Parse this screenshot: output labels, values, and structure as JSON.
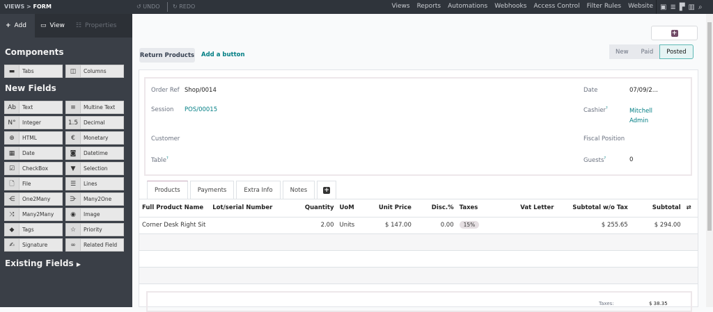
{
  "topbar": {
    "breadcrumb_views": "VIEWS",
    "breadcrumb_sep": ">",
    "breadcrumb_form": "FORM",
    "undo": "UNDO",
    "redo": "REDO",
    "nav": [
      "Views",
      "Reports",
      "Automations",
      "Webhooks",
      "Access Control",
      "Filter Rules",
      "Website"
    ],
    "view_icons": [
      "form-view-icon",
      "list-view-icon",
      "kanban-view-icon",
      "pivot-view-icon",
      "search-icon"
    ]
  },
  "sidebar": {
    "tabs": [
      {
        "label": "Add",
        "icon": "plus-icon"
      },
      {
        "label": "View",
        "icon": "monitor-icon"
      },
      {
        "label": "Properties",
        "icon": "properties-icon"
      }
    ],
    "components_title": "Components",
    "components": [
      {
        "label": "Tabs",
        "icon": "tabs-icon"
      },
      {
        "label": "Columns",
        "icon": "columns-icon"
      }
    ],
    "new_fields_title": "New Fields",
    "fields": [
      {
        "label": "Text",
        "icon": "Ab"
      },
      {
        "label": "Multine Text",
        "icon": "≡"
      },
      {
        "label": "Integer",
        "icon": "N°"
      },
      {
        "label": "Decimal",
        "icon": "1.5"
      },
      {
        "label": "HTML",
        "icon": "⊕"
      },
      {
        "label": "Monetary",
        "icon": "€"
      },
      {
        "label": "Date",
        "icon": "▦"
      },
      {
        "label": "Datetime",
        "icon": "◙"
      },
      {
        "label": "CheckBox",
        "icon": "☑"
      },
      {
        "label": "Selection",
        "icon": "▼"
      },
      {
        "label": "File",
        "icon": "🗋"
      },
      {
        "label": "Lines",
        "icon": "☰"
      },
      {
        "label": "One2Many",
        "icon": "⋲"
      },
      {
        "label": "Many2One",
        "icon": "⋺"
      },
      {
        "label": "Many2Many",
        "icon": "⤨"
      },
      {
        "label": "Image",
        "icon": "◉"
      },
      {
        "label": "Tags",
        "icon": "◆"
      },
      {
        "label": "Priority",
        "icon": "☆"
      },
      {
        "label": "Signature",
        "icon": "✍"
      },
      {
        "label": "Related Field",
        "icon": "∞"
      }
    ],
    "existing_fields": "Existing Fields"
  },
  "main": {
    "return_button": "Return Products",
    "add_button": "Add a button",
    "statusbar": [
      "New",
      "Paid",
      "Posted"
    ],
    "status_current": "Posted",
    "form": {
      "order_ref_label": "Order Ref",
      "order_ref": "Shop/0014",
      "session_label": "Session",
      "session": "POS/00015",
      "customer_label": "Customer",
      "table_label": "Table",
      "help": "?",
      "date_label": "Date",
      "date": "07/09/2...",
      "cashier_label": "Cashier",
      "cashier_1": "Mitchell",
      "cashier_2": "Admin",
      "fiscal_label": "Fiscal Position",
      "guests_label": "Guests",
      "guests": "0"
    },
    "tabs": [
      "Products",
      "Payments",
      "Extra Info",
      "Notes"
    ],
    "columns": [
      "Full Product Name",
      "Lot/serial Number",
      "Quantity",
      "UoM",
      "Unit Price",
      "Disc.%",
      "Taxes",
      "Vat Letter",
      "Subtotal w/o Tax",
      "Subtotal"
    ],
    "rows": [
      {
        "name": "Corner Desk Right Sit",
        "lot": "",
        "qty": "2.00",
        "uom": "Units",
        "price": "$ 147.00",
        "disc": "0.00",
        "taxes": "15%",
        "vat": "",
        "subtotal_wo": "$ 255.65",
        "subtotal": "$ 294.00"
      }
    ],
    "totals": {
      "taxes_label": "Taxes:",
      "taxes": "$ 38.35"
    }
  },
  "colors": {
    "topbar": "#2f343b",
    "sidebar": "#3a3f47",
    "accent": "#017e84",
    "brand": "#714b67"
  }
}
